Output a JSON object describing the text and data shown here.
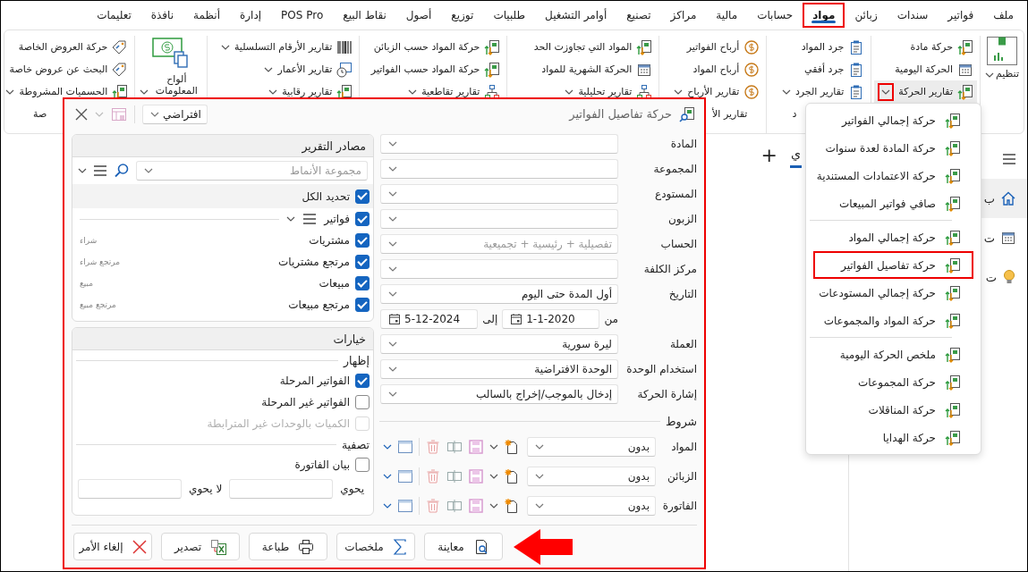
{
  "menu_bar": {
    "tabs": [
      {
        "label": "ملف",
        "selected": false,
        "highlighted": false
      },
      {
        "label": "فواتير",
        "selected": false,
        "highlighted": false
      },
      {
        "label": "سندات",
        "selected": false,
        "highlighted": false
      },
      {
        "label": "زبائن",
        "selected": false,
        "highlighted": false
      },
      {
        "label": "مواد",
        "selected": true,
        "highlighted": true
      },
      {
        "label": "حسابات",
        "selected": false,
        "highlighted": false
      },
      {
        "label": "مالية",
        "selected": false,
        "highlighted": false
      },
      {
        "label": "مراكز",
        "selected": false,
        "highlighted": false
      },
      {
        "label": "تصنيع",
        "selected": false,
        "highlighted": false
      },
      {
        "label": "أوامر التشغيل",
        "selected": false,
        "highlighted": false
      },
      {
        "label": "طلبيات",
        "selected": false,
        "highlighted": false
      },
      {
        "label": "توزيع",
        "selected": false,
        "highlighted": false
      },
      {
        "label": "أصول",
        "selected": false,
        "highlighted": false
      },
      {
        "label": "نقاط البيع",
        "selected": false,
        "highlighted": false
      },
      {
        "label": "POS Pro",
        "selected": false,
        "highlighted": false
      },
      {
        "label": "إدارة",
        "selected": false,
        "highlighted": false
      },
      {
        "label": "أنظمة",
        "selected": false,
        "highlighted": false
      },
      {
        "label": "نافذة",
        "selected": false,
        "highlighted": false
      },
      {
        "label": "تعليمات",
        "selected": false,
        "highlighted": false
      }
    ]
  },
  "ribbon": {
    "groups": [
      {
        "kind": "big",
        "items": [
          {
            "label": "تنظيم",
            "dropdown": true,
            "open": false
          }
        ]
      },
      {
        "kind": "stack",
        "items": [
          {
            "label": "حركة مادة",
            "dropdown": false,
            "open": false
          },
          {
            "label": "الحركة اليومية",
            "dropdown": false,
            "open": false
          },
          {
            "label": "تقارير الحركة",
            "dropdown": true,
            "open": true
          }
        ]
      },
      {
        "kind": "stack",
        "caption": "د",
        "items": [
          {
            "label": "جرد المواد",
            "dropdown": false,
            "open": false
          },
          {
            "label": "جرد أفقي",
            "dropdown": false,
            "open": false
          },
          {
            "label": "تقارير الجرد",
            "dropdown": true,
            "open": false
          }
        ]
      },
      {
        "kind": "stack",
        "caption": "تقارير الأ",
        "items": [
          {
            "label": "أرباح الفواتير",
            "dropdown": false,
            "open": false
          },
          {
            "label": "أرباح المواد",
            "dropdown": false,
            "open": false
          },
          {
            "label": "تقارير الأرباح",
            "dropdown": true,
            "open": false
          }
        ]
      },
      {
        "kind": "stack",
        "items": [
          {
            "label": "المواد التي تجاوزت الحد",
            "dropdown": false,
            "open": false
          },
          {
            "label": "الحركة الشهرية للمواد",
            "dropdown": false,
            "open": false
          },
          {
            "label": "تقارير تحليلية",
            "dropdown": true,
            "open": false
          }
        ]
      },
      {
        "kind": "stack",
        "items": [
          {
            "label": "حركة المواد حسب الزبائن",
            "dropdown": false,
            "open": false
          },
          {
            "label": "حركة المواد حسب الفواتير",
            "dropdown": false,
            "open": false
          },
          {
            "label": "تقارير تقاطعية",
            "dropdown": true,
            "open": false
          }
        ]
      },
      {
        "kind": "stack",
        "items": [
          {
            "label": "تقارير الأرقام التسلسلية",
            "dropdown": true,
            "open": false
          },
          {
            "label": "تقارير الأعمار",
            "dropdown": true,
            "open": false
          },
          {
            "label": "تقارير رقابية",
            "dropdown": true,
            "open": false
          }
        ]
      },
      {
        "kind": "big",
        "items": [
          {
            "label": "ألواح المعلومات",
            "dropdown": true,
            "open": false
          }
        ]
      },
      {
        "kind": "stack",
        "caption": "صة",
        "items": [
          {
            "label": "حركة العروض الخاصة",
            "dropdown": false,
            "open": false
          },
          {
            "label": "البحث عن عروض خاصة",
            "dropdown": false,
            "open": false
          },
          {
            "label": "الحسميات المشروطة",
            "dropdown": true,
            "open": false
          }
        ]
      }
    ]
  },
  "workspace": {
    "tabs": [
      {
        "label": "ي",
        "selected": true
      }
    ],
    "add_tab": "+",
    "sidebar": {
      "items": [
        {
          "label": "ب",
          "selected": true
        },
        {
          "label": "ت",
          "selected": false
        },
        {
          "label": "ت",
          "selected": false
        }
      ]
    }
  },
  "report_dialog": {
    "title": "حركة تفاصيل الفواتير",
    "highlighted": true,
    "template": {
      "value": "افتراضي"
    },
    "filters": [
      {
        "kind": "combo",
        "label": "المادة"
      },
      {
        "kind": "combo",
        "label": "المجموعة"
      },
      {
        "kind": "combo",
        "label": "المستودع"
      },
      {
        "kind": "combo",
        "label": "الزبون"
      },
      {
        "kind": "combo",
        "label": "الحساب",
        "placeholder": "تفصيلية + رئيسية + تجميعية"
      },
      {
        "kind": "combo",
        "label": "مركز الكلفة"
      },
      {
        "kind": "combo",
        "label": "التاريخ",
        "value": "أول المدة حتى اليوم"
      },
      {
        "kind": "date_range",
        "from_label": "من",
        "from": "1-1-2020",
        "to_label": "إلى",
        "to": "5-12-2024"
      },
      {
        "kind": "combo",
        "label": "العملة",
        "value": "ليرة سورية"
      },
      {
        "kind": "combo",
        "label": "استخدام الوحدة",
        "value": "الوحدة الافتراضية"
      },
      {
        "kind": "combo",
        "label": "إشارة الحركة",
        "value": "إدخال بالموجب/إخراج بالسالب"
      }
    ],
    "conditions": {
      "title": "شروط",
      "rows": [
        {
          "label": "المواد",
          "value": "بدون"
        },
        {
          "label": "الزبائن",
          "value": "بدون"
        },
        {
          "label": "الفاتورة",
          "value": "بدون"
        }
      ]
    },
    "sources": {
      "title": "مصادر التقرير",
      "pattern_group": {
        "placeholder": "مجموعة الأنماط"
      },
      "select_all": {
        "label": "تحديد الكل",
        "checked": true
      },
      "tree": [
        {
          "label": "فواتير",
          "checked": true,
          "children": [
            {
              "label": "مشتريات",
              "note": "شراء",
              "checked": true
            },
            {
              "label": "مرتجع مشتريات",
              "note": "مرتجع شراء",
              "checked": true
            },
            {
              "label": "مبيعات",
              "note": "مبيع",
              "checked": true
            },
            {
              "label": "مرتجع مبيعات",
              "note": "مرتجع مبيع",
              "checked": true
            }
          ]
        }
      ]
    },
    "options": {
      "title": "خيارات",
      "show": {
        "title": "إظهار",
        "items": [
          {
            "label": "الفواتير المرحلة",
            "checked": true,
            "disabled": false
          },
          {
            "label": "الفواتير غير المرحلة",
            "checked": false,
            "disabled": false
          },
          {
            "label": "الكميات بالوحدات غير المترابطة",
            "checked": false,
            "disabled": true
          }
        ]
      },
      "filter": {
        "title": "تصفية",
        "items": [
          {
            "label": "بيان الفاتورة",
            "checked": false,
            "disabled": false
          }
        ],
        "contains_label": "يحوي",
        "not_contains_label": "لا يحوي"
      }
    },
    "buttons": [
      {
        "label": "معاينة",
        "callout_arrow": true
      },
      {
        "label": "ملخصات",
        "callout_arrow": false
      },
      {
        "label": "طباعة",
        "callout_arrow": false
      },
      {
        "label": "تصدير",
        "callout_arrow": false
      },
      {
        "label": "إلغاء الأمر",
        "callout_arrow": false
      }
    ]
  },
  "movement_menu": {
    "sections": [
      {
        "items": [
          {
            "label": "حركة إجمالي الفواتير",
            "highlighted": false
          },
          {
            "label": "حركة المادة لعدة سنوات",
            "highlighted": false
          },
          {
            "label": "حركة الاعتمادات المستندية",
            "highlighted": false
          },
          {
            "label": "صافي فواتير المبيعات",
            "highlighted": false
          }
        ]
      },
      {
        "items": [
          {
            "label": "حركة إجمالي المواد",
            "highlighted": false
          },
          {
            "label": "حركة تفاصيل الفواتير",
            "highlighted": true
          },
          {
            "label": "حركة إجمالي المستودعات",
            "highlighted": false
          },
          {
            "label": "حركة المواد والمجموعات",
            "highlighted": false
          }
        ]
      },
      {
        "items": [
          {
            "label": "ملخص الحركة اليومية",
            "highlighted": false
          },
          {
            "label": "حركة المجموعات",
            "highlighted": false
          },
          {
            "label": "حركة المناقلات",
            "highlighted": false
          },
          {
            "label": "حركة الهدايا",
            "highlighted": false
          }
        ]
      }
    ]
  }
}
